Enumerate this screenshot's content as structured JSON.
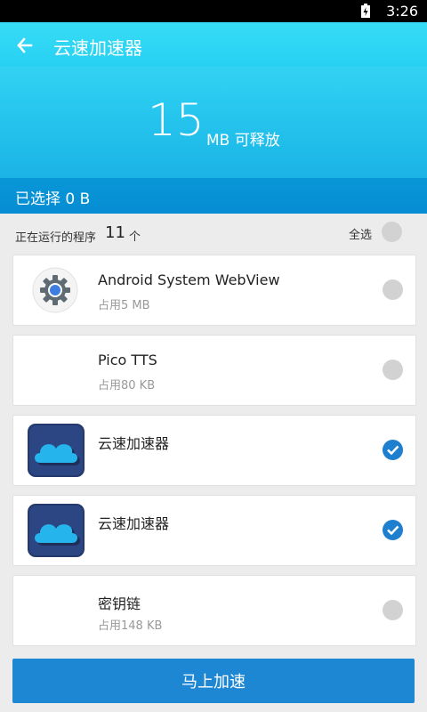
{
  "status_bar": {
    "time": "3:26"
  },
  "header": {
    "title": "云速加速器"
  },
  "summary": {
    "freeable_value": "15",
    "freeable_unit": "MB 可释放",
    "selected_text": "已选择 0 B"
  },
  "running": {
    "label": "正在运行的程序",
    "count": "11",
    "unit": "个",
    "select_all_label": "全选"
  },
  "apps": [
    {
      "name": "Android System WebView",
      "size": "占用5 MB",
      "icon": "webview-gear-icon",
      "checked": false
    },
    {
      "name": "Pico TTS",
      "size": "占用80 KB",
      "icon": "",
      "checked": false
    },
    {
      "name": "云速加速器",
      "size": "",
      "icon": "cloud-app-icon",
      "checked": true
    },
    {
      "name": "云速加速器",
      "size": "",
      "icon": "cloud-app-icon",
      "checked": true
    },
    {
      "name": "密钥链",
      "size": "占用148 KB",
      "icon": "",
      "checked": false
    }
  ],
  "action": {
    "accelerate_label": "马上加速"
  },
  "colors": {
    "accent": "#1e87d4",
    "hero_top": "#37dcf6",
    "hero_bottom": "#0a9ee0",
    "check_on": "#1f7fcf",
    "check_off": "#d2d2d2"
  }
}
